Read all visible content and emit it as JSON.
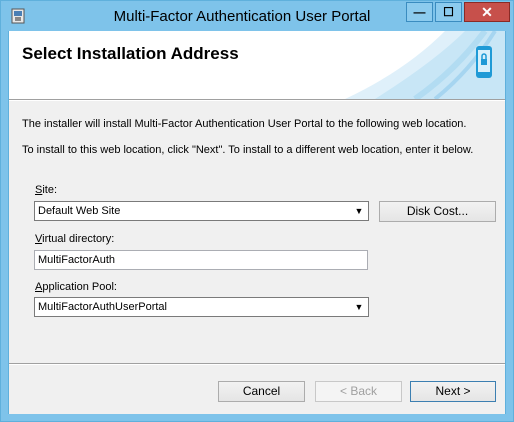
{
  "window": {
    "title": "Multi-Factor Authentication User Portal",
    "controls": {
      "minimize": "—",
      "maximize": "☐",
      "close": "✕"
    }
  },
  "banner": {
    "heading": "Select Installation Address"
  },
  "body": {
    "intro": "The installer will install Multi-Factor Authentication User Portal to the following web location.",
    "instruction": "To install to this web location, click \"Next\". To install to a different web location, enter it below."
  },
  "site": {
    "label_access": "S",
    "label_rest": "ite:",
    "value": "Default Web Site"
  },
  "virtual_directory": {
    "label_access": "V",
    "label_rest": "irtual directory:",
    "value": "MultiFactorAuth"
  },
  "app_pool": {
    "label_access": "A",
    "label_rest": "pplication Pool:",
    "value": "MultiFactorAuthUserPortal"
  },
  "buttons": {
    "disk_cost": "Disk Cost...",
    "cancel": "Cancel",
    "back": "< Back",
    "next": "Next >"
  },
  "colors": {
    "title_bar": "#7ec3ea",
    "close_button": "#c7504b",
    "dialog_bg": "#f0f0f0"
  }
}
